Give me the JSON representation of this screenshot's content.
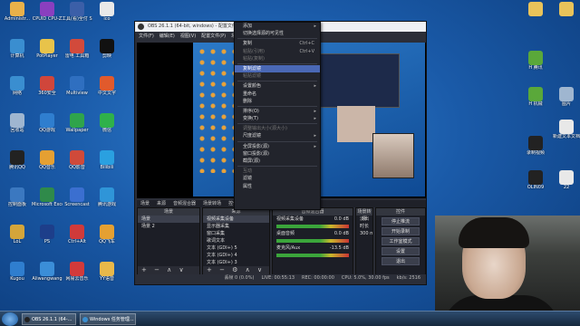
{
  "desktop": {
    "left_icons": [
      {
        "label": "Administr...",
        "color": "#e9b14a"
      },
      {
        "label": "CPUID CPU-Z",
        "color": "#8a3fbf"
      },
      {
        "label": "工具(看)全付 Spermaster",
        "color": "#3b5fa8"
      },
      {
        "label": "ico",
        "color": "#e9e9e9"
      },
      {
        "label": "计算机",
        "color": "#3a8ed0"
      },
      {
        "label": "PotPlayer",
        "color": "#e8c34a"
      },
      {
        "label": "雷电 工具箱",
        "color": "#d24a3b"
      },
      {
        "label": "剪映",
        "color": "#111111"
      },
      {
        "label": "网络",
        "color": "#3a8ed0"
      },
      {
        "label": "360安全",
        "color": "#d0463b"
      },
      {
        "label": "Multiview",
        "color": "#2f6fc0"
      },
      {
        "label": "中文文字",
        "color": "#e15a2c"
      },
      {
        "label": "回收站",
        "color": "#9fb6d0"
      },
      {
        "label": "QQ游戏",
        "color": "#2f7ecf"
      },
      {
        "label": "Wallpaper",
        "color": "#2fa44b"
      },
      {
        "label": "微信",
        "color": "#2fb14a"
      },
      {
        "label": "腾讯QQ",
        "color": "#222222"
      },
      {
        "label": "QQ音乐",
        "color": "#e5a032"
      },
      {
        "label": "QQ影音",
        "color": "#d04a3a"
      },
      {
        "label": "Bilibili",
        "color": "#2aa0e0"
      },
      {
        "label": "控制面板",
        "color": "#3b78c0"
      },
      {
        "label": "Microsoft Excel",
        "color": "#2f8a4a"
      },
      {
        "label": "Screencast",
        "color": "#3b6fd0"
      },
      {
        "label": "腾讯游戏",
        "color": "#2f95d8"
      },
      {
        "label": "LoL",
        "color": "#d4a53a"
      },
      {
        "label": "PS",
        "color": "#1d3e8a"
      },
      {
        "label": "Ctrl+Alt",
        "color": "#d03a3a"
      },
      {
        "label": "QQ飞车",
        "color": "#e5a032"
      },
      {
        "label": "Kugou",
        "color": "#2f7ecf"
      },
      {
        "label": "Aliwangwang",
        "color": "#3b8ed8"
      },
      {
        "label": "网易云音乐",
        "color": "#d23a3a"
      },
      {
        "label": "YY语音",
        "color": "#e8b84a"
      }
    ],
    "right_icons": [
      {
        "label": "",
        "color": "#e9c35a"
      },
      {
        "label": "",
        "color": "#e9c35a"
      },
      {
        "label": "H 腾讯",
        "color": "#5aa83a"
      },
      {
        "label": "H 机械",
        "color": "#5aa83a"
      },
      {
        "label": "图片",
        "color": "#9fb6d0"
      },
      {
        "label": "新建文本文档",
        "color": "#e8e8e8"
      },
      {
        "label": "录制视频",
        "color": "#222222"
      },
      {
        "label": "OLIN09",
        "color": "#222222"
      },
      {
        "label": "22",
        "color": "#e8e8e8"
      }
    ]
  },
  "obs": {
    "title": "OBS 26.1.1 (64-bit, windows) - 配置文件: 未命名 - 场景: 未命名",
    "menu": [
      "文件(F)",
      "编辑(E)",
      "视图(V)",
      "配置文件(P)",
      "场景集合(S)",
      "工具(T)",
      "帮助(H)"
    ],
    "dock_tabs": [
      "场景",
      "来源",
      "音频混合器",
      "场景转场",
      "控件"
    ],
    "scenes_header": "场景",
    "scenes": [
      "场景",
      "场景 2"
    ],
    "sources_header": "来源",
    "sources": [
      "视频采集设备",
      "显示器采集",
      "窗口采集",
      "歌词文本",
      "文本 (GDI+) 5",
      "文本 (GDI+) 4",
      "文本 (GDI+) 3",
      "文本 (GDI+) 2"
    ],
    "mixer_header": "音频混合器",
    "mixer_tracks": [
      {
        "name": "视频采集设备",
        "db": "0.0 dB"
      },
      {
        "name": "桌面音频",
        "db": "0.0 dB"
      },
      {
        "name": "麦克风/Aux",
        "db": "-13.5 dB"
      }
    ],
    "transition_header": "场景转场",
    "transition_name": "淡出",
    "transition_duration_label": "时长",
    "transition_duration": "300 ms",
    "controls_header": "控件",
    "controls": [
      "停止推流",
      "开始录制",
      "工作室模式",
      "设置",
      "退出"
    ],
    "status": {
      "dropped": "丢帧 0 (0.0%)",
      "live": "LIVE: 00:55:13",
      "rec": "REC: 00:00:00",
      "cpu": "CPU: 5.0%, 30.00 fps",
      "kbps": "kb/s: 2516"
    },
    "context_menu": [
      {
        "label": "添加",
        "arrow": true
      },
      {
        "label": "切换选择源的可见性",
        "arrow": false
      },
      {
        "sep": true
      },
      {
        "label": "复制",
        "shortcut": "Ctrl+C"
      },
      {
        "label": "粘贴(引用)",
        "shortcut": "Ctrl+V",
        "disabled": true
      },
      {
        "label": "粘贴(复制)",
        "disabled": true
      },
      {
        "sep": true
      },
      {
        "label": "复制滤镜",
        "highlight": true
      },
      {
        "label": "粘贴滤镜",
        "disabled": true
      },
      {
        "sep": true
      },
      {
        "label": "设置颜色",
        "arrow": true
      },
      {
        "label": "重命名"
      },
      {
        "label": "删除"
      },
      {
        "sep": true
      },
      {
        "label": "排序(O)",
        "arrow": true
      },
      {
        "label": "变换(T)",
        "arrow": true
      },
      {
        "sep": true
      },
      {
        "label": "调整输出大小(源大小)",
        "disabled": true
      },
      {
        "label": "尺度滤镜",
        "arrow": true
      },
      {
        "sep": true
      },
      {
        "label": "全屏投影(源)",
        "arrow": true
      },
      {
        "label": "窗口投影(源)"
      },
      {
        "label": "截屏(源)"
      },
      {
        "sep": true
      },
      {
        "label": "互动",
        "disabled": true
      },
      {
        "label": "滤镜"
      },
      {
        "label": "属性"
      }
    ]
  },
  "taskbar": {
    "items": [
      "OBS 26.1.1 (64-...",
      "Windows 任务管理..."
    ]
  }
}
